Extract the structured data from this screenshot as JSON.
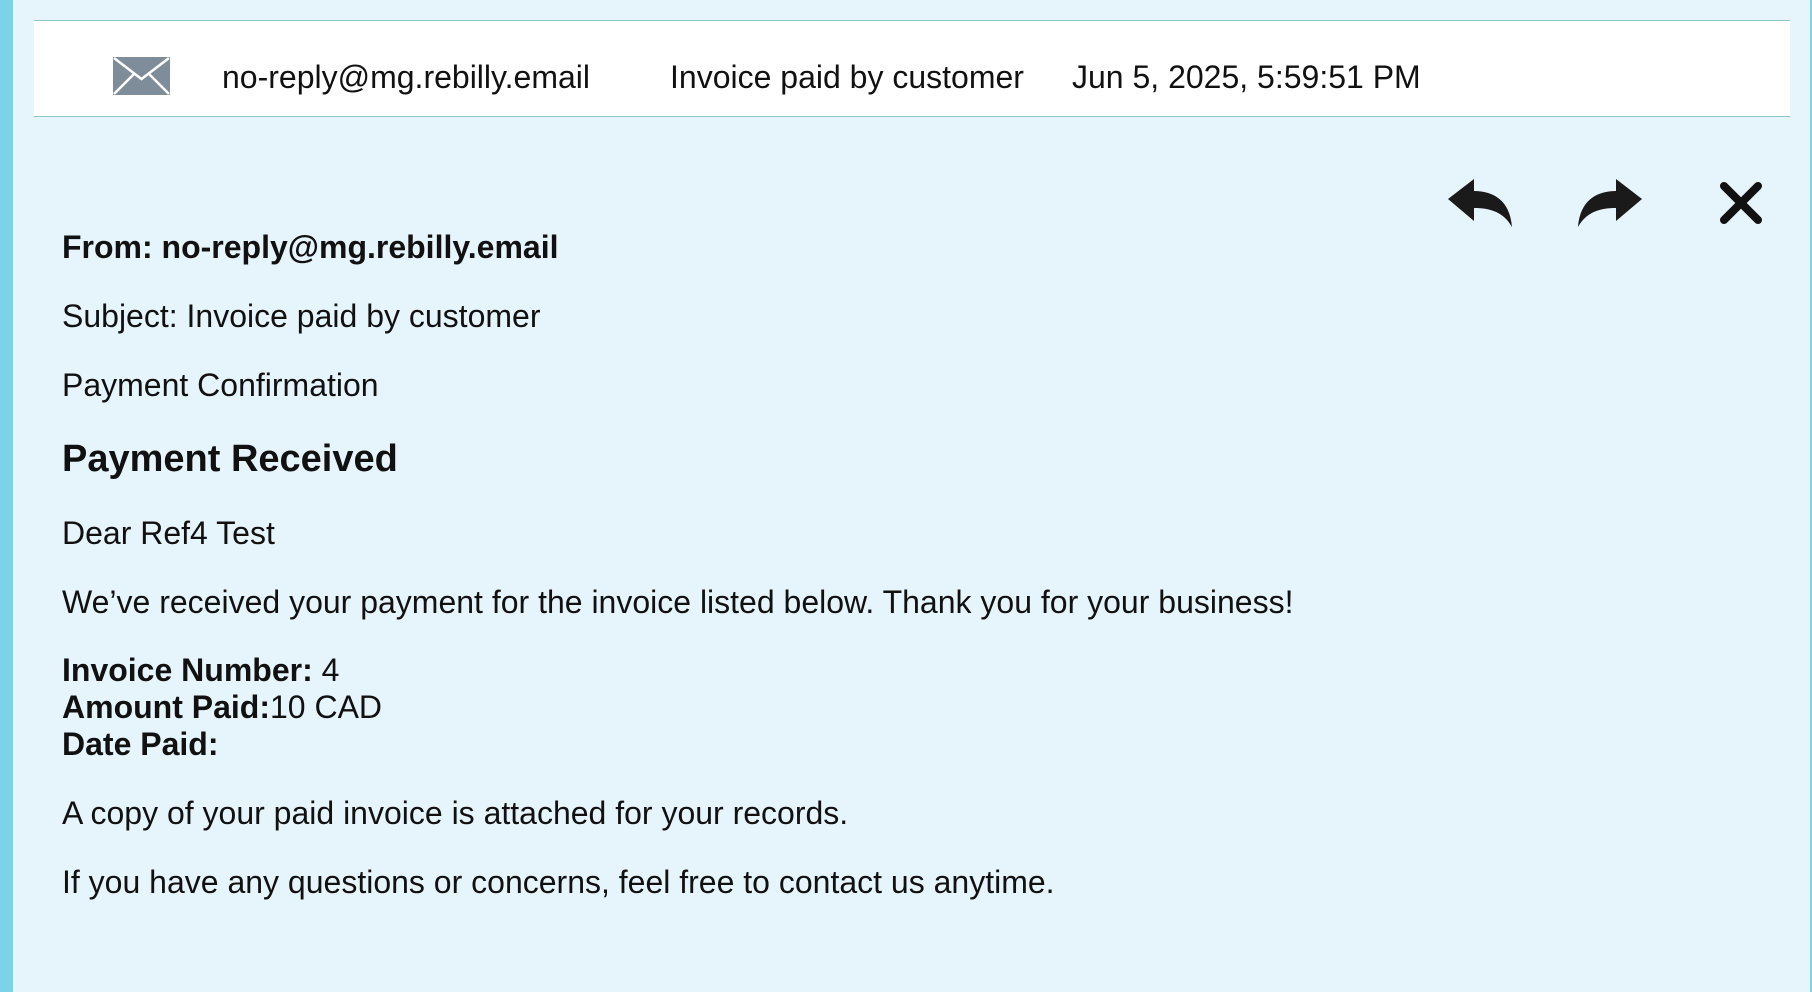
{
  "list_row": {
    "from": "no-reply@mg.rebilly.email",
    "subject": "Invoice paid by customer",
    "date": "Jun 5, 2025, 5:59:51 PM",
    "icon": "envelope-icon"
  },
  "toolbar": {
    "reply_icon": "reply-icon",
    "forward_icon": "forward-icon",
    "close_icon": "close-icon"
  },
  "message": {
    "from_line": "From: no-reply@mg.rebilly.email",
    "subject_line": "Subject: Invoice paid by customer",
    "preheader": "Payment Confirmation",
    "heading": "Payment Received",
    "greeting": "Dear Ref4 Test",
    "intro": "We’ve received your payment for the invoice listed below. Thank you for your business!",
    "details": {
      "invoice_number_label": "Invoice Number:",
      "invoice_number_value": " 4",
      "amount_paid_label": "Amount Paid:",
      "amount_paid_value": "10 CAD",
      "date_paid_label": "Date Paid:",
      "date_paid_value": ""
    },
    "attachment_note": "A copy of your paid invoice is attached for your records.",
    "closing": "If you have any questions or concerns, feel free to contact us anytime."
  },
  "colors": {
    "background": "#e6f4fc",
    "accent_strip": "#7bd3e8",
    "row_border": "#8cc7c9"
  }
}
